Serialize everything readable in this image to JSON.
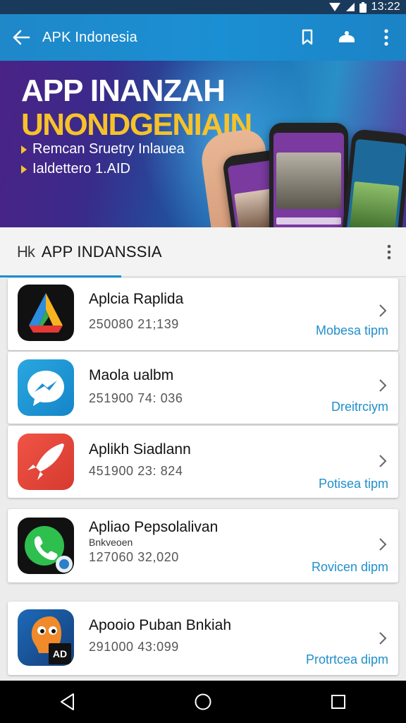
{
  "status_bar": {
    "time": "13:22"
  },
  "app_bar": {
    "title": "APK Indonesia"
  },
  "banner": {
    "headline_1": "APP INANZAH",
    "headline_2": "UNONDGENIAIN",
    "line_1": "Remcan Sruetry Inlauea",
    "line_2": "Ialdettero 1.AID"
  },
  "section": {
    "icon_text": "Hk",
    "title": "APP INDANSSIA"
  },
  "apps": [
    {
      "name": "Aplcia Raplida",
      "sub": "",
      "meta": "250080 21;139",
      "action": "Mobesa tipm"
    },
    {
      "name": "Maola ualbm",
      "sub": "",
      "meta": "251900 74: 036",
      "action": "Dreitrciym"
    },
    {
      "name": "Aplikh Siadlann",
      "sub": "",
      "meta": "451900 23: 824",
      "action": "Potisea tipm"
    },
    {
      "name": "Apliao Pepsolalivan",
      "sub": "Bnkveoen",
      "meta": "127060 32,020",
      "action": "Rovicen dipm"
    },
    {
      "name": "Apooio Puban Bnkiah",
      "sub": "",
      "meta": "291000 43:099",
      "action": "Protrtcea dipm"
    }
  ],
  "icons": {
    "app_1": "triangle-logo-icon",
    "app_2": "messenger-icon",
    "app_3": "rocket-icon",
    "app_4": "phone-call-icon",
    "app_5": "mascot-icon"
  },
  "colors": {
    "accent": "#1b8fd3",
    "action_text": "#1f8fcc",
    "banner_yellow": "#f6c22b"
  }
}
